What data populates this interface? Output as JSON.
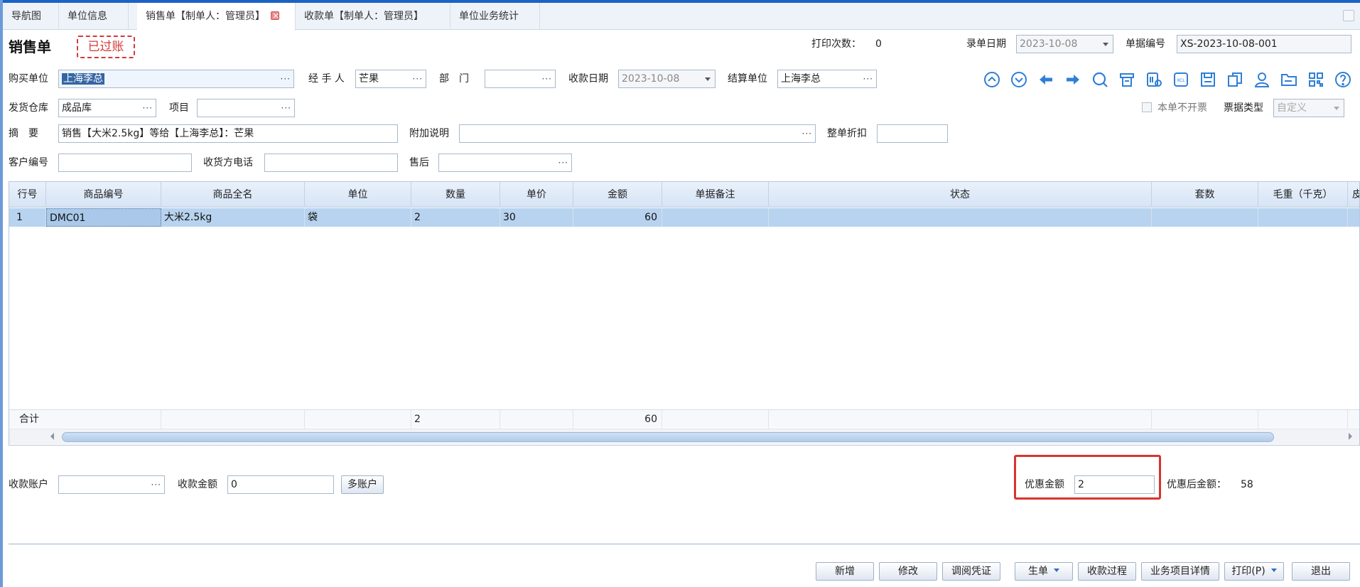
{
  "tabs": [
    {
      "label": "导航图"
    },
    {
      "label": "单位信息"
    },
    {
      "label": "销售单【制单人：管理员】"
    },
    {
      "label": "收款单【制单人：管理员】"
    },
    {
      "label": "单位业务统计"
    }
  ],
  "header": {
    "title": "销售单",
    "stamp": "已过账",
    "print_count_label": "打印次数：",
    "print_count": "0",
    "entry_date_label": "录单日期",
    "entry_date": "2023-10-08",
    "doc_no_label": "单据编号",
    "doc_no": "XS-2023-10-08-001"
  },
  "form": {
    "buyer_label": "购买单位",
    "buyer": "上海李总",
    "handler_label": "经 手 人",
    "handler": "芒果",
    "dept_label": "部　门",
    "dept": "",
    "receipt_date_label": "收款日期",
    "receipt_date": "2023-10-08",
    "settle_unit_label": "结算单位",
    "settle_unit": "上海李总",
    "warehouse_label": "发货仓库",
    "warehouse": "成品库",
    "project_label": "项目",
    "project": "",
    "no_invoice_label": "本单不开票",
    "invoice_type_label": "票据类型",
    "invoice_type": "自定义",
    "summary_label": "摘　要",
    "summary": "销售【大米2.5kg】等给【上海李总】：芒果",
    "remark_label": "附加说明",
    "remark": "",
    "discount_label": "整单折扣",
    "discount": "",
    "customer_no_label": "客户编号",
    "customer_no": "",
    "receiver_phone_label": "收货方电话",
    "receiver_phone": "",
    "after_sale_label": "售后",
    "after_sale": ""
  },
  "toolbar_icons": [
    "arrow-up-circle-icon",
    "arrow-down-circle-icon",
    "arrow-left-icon",
    "arrow-right-icon",
    "search-icon",
    "printer-icon",
    "barcode-setting-icon",
    "excel-icon",
    "save-icon",
    "document-export-icon",
    "person-icon",
    "folder-icon",
    "qrcode-icon",
    "help-icon"
  ],
  "grid": {
    "columns": [
      "行号",
      "商品编号",
      "商品全名",
      "单位",
      "数量",
      "单价",
      "金额",
      "单据备注",
      "状态",
      "套数",
      "毛重（千克）",
      "皮"
    ],
    "rows": [
      [
        "1",
        "DMC01",
        "大米2.5kg",
        "袋",
        "2",
        "30",
        "60",
        "",
        "",
        "",
        "",
        ""
      ]
    ],
    "footer": {
      "label": "合计",
      "quantity": "2",
      "amount": "60"
    }
  },
  "payment": {
    "account_label": "收款账户",
    "account": "",
    "amount_label": "收款金额",
    "amount": "0",
    "multi_account_button": "多账户",
    "discount_amount_label": "优惠金额",
    "discount_amount": "2",
    "after_discount_label": "优惠后金额：",
    "after_discount": "58"
  },
  "buttons": {
    "new": "新增",
    "edit": "修改",
    "voucher": "调阅凭证",
    "generate": "生单",
    "receipt_process": "收款过程",
    "project_detail": "业务项目详情",
    "print": "打印(P)",
    "exit": "退出"
  },
  "colors": {
    "accent": "#2f7fd6",
    "selected_row": "#b8d3ef",
    "highlight_border": "#d9332e",
    "stamp": "#d43a3a"
  }
}
